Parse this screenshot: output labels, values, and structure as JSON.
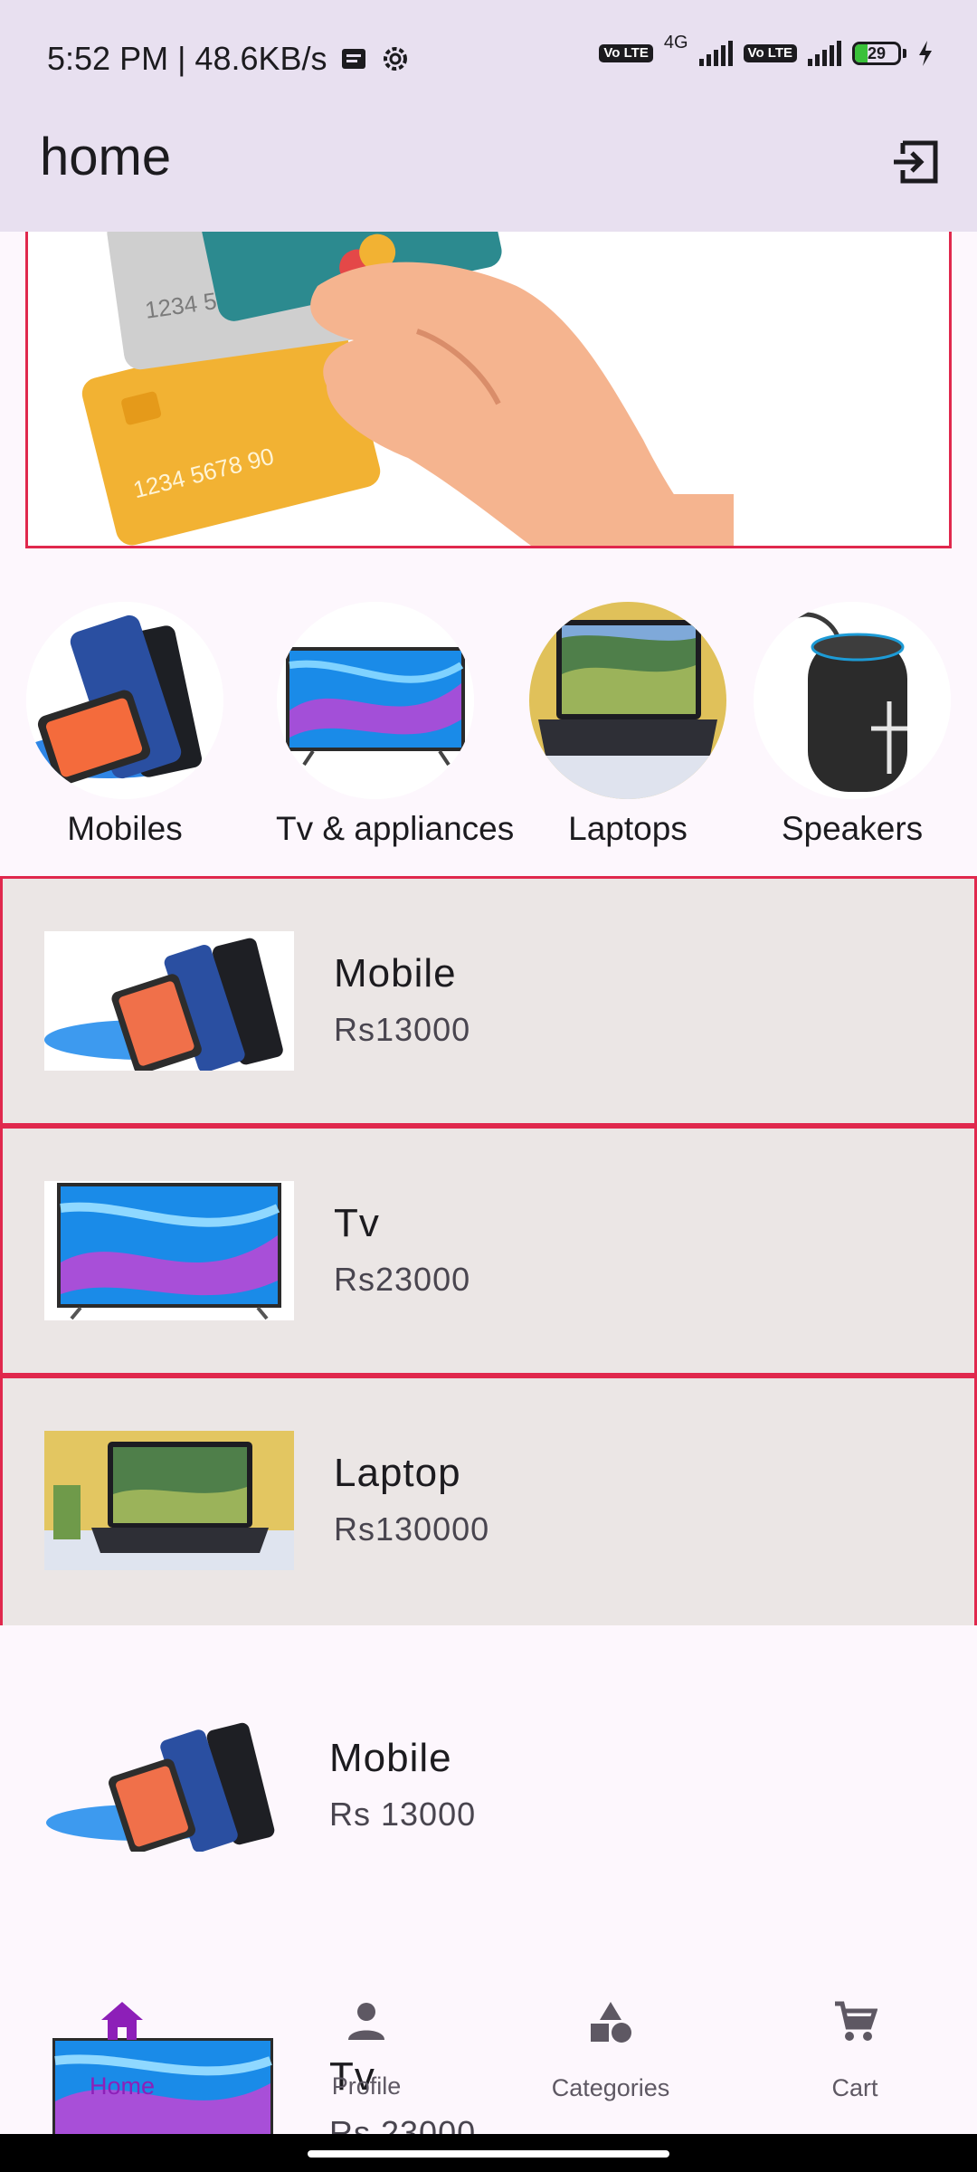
{
  "status_bar": {
    "time_speed": "5:52 PM | 48.6KB/s",
    "volte1": "Vo LTE",
    "network": "4G",
    "volte2": "Vo LTE",
    "battery_level": "29"
  },
  "app_bar": {
    "title": "home",
    "logout_icon": "logout-icon"
  },
  "colors": {
    "accent": "#8d1fb8",
    "row_border": "#e0284d",
    "row_bg": "#ebe6e5",
    "app_bar_bg": "#e8e0f0"
  },
  "categories": [
    {
      "label": "Mobiles"
    },
    {
      "label": "Tv & appliances"
    },
    {
      "label": "Laptops"
    },
    {
      "label": "Speakers"
    }
  ],
  "products": [
    {
      "name": "Mobile",
      "price": "Rs13000"
    },
    {
      "name": "Tv",
      "price": "Rs23000"
    },
    {
      "name": "Laptop",
      "price": "Rs130000"
    }
  ],
  "products_plain": [
    {
      "name": "Mobile",
      "price": "Rs 13000"
    },
    {
      "name": "Tv",
      "price": "Rs 23000"
    }
  ],
  "bottom_nav": {
    "items": [
      {
        "label": "Home",
        "icon": "home-icon",
        "active": true
      },
      {
        "label": "Profile",
        "icon": "person-icon",
        "active": false
      },
      {
        "label": "Categories",
        "icon": "shapes-icon",
        "active": false
      },
      {
        "label": "Cart",
        "icon": "cart-icon",
        "active": false
      }
    ]
  }
}
